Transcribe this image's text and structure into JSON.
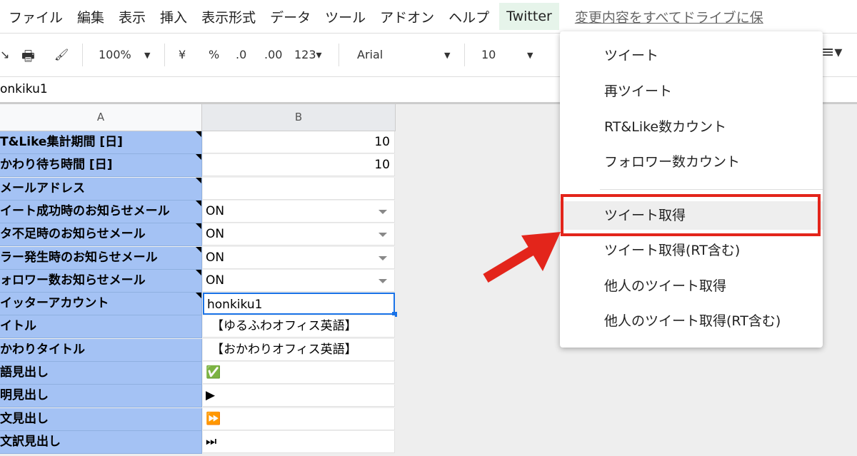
{
  "menubar": {
    "items": [
      "ファイル",
      "編集",
      "表示",
      "挿入",
      "表示形式",
      "データ",
      "ツール",
      "アドオン",
      "ヘルプ"
    ],
    "twitter": "Twitter",
    "save_status": "変更内容をすべてドライブに保"
  },
  "toolbar": {
    "zoom": "100%",
    "currency": "¥",
    "percent": "%",
    "dec_less": ".0",
    "dec_more": ".00",
    "format": "123▾",
    "font": "Arial",
    "size": "10"
  },
  "formula_bar": {
    "value": "onkiku1"
  },
  "columns": [
    "A",
    "B"
  ],
  "rows": [
    {
      "a": "T&Like集計期間 [日]",
      "b": "10",
      "type": "num"
    },
    {
      "a": "かわり待ち時間 [日]",
      "b": "10",
      "type": "num"
    },
    {
      "a": "メールアドレス",
      "b": "",
      "type": "text"
    },
    {
      "a": "イート成功時のお知らせメール",
      "b": "ON",
      "type": "dd"
    },
    {
      "a": "タ不足時のお知らせメール",
      "b": "ON",
      "type": "dd"
    },
    {
      "a": "ラー発生時のお知らせメール",
      "b": "ON",
      "type": "dd"
    },
    {
      "a": "ォロワー数お知らせメール",
      "b": "ON",
      "type": "dd"
    },
    {
      "a": "イッターアカウント",
      "b": "honkiku1",
      "type": "sel"
    },
    {
      "a": "イトル",
      "b": "【ゆるふわオフィス英語】",
      "type": "text"
    },
    {
      "a": "かわりタイトル",
      "b": "【おかわりオフィス英語】",
      "type": "text"
    },
    {
      "a": "語見出し",
      "b": "✅",
      "type": "text"
    },
    {
      "a": "明見出し",
      "b": "▶",
      "type": "text"
    },
    {
      "a": "文見出し",
      "b": "⏩",
      "type": "text"
    },
    {
      "a": "文訳見出し",
      "b": "⏭",
      "type": "text"
    }
  ],
  "twitter_menu": {
    "items": [
      "ツイート",
      "再ツイート",
      "RT&Like数カウント",
      "フォロワー数カウント",
      "ツイート取得",
      "ツイート取得(RT含む)",
      "他人のツイート取得",
      "他人のツイート取得(RT含む)"
    ],
    "highlighted": "ツイート取得"
  },
  "colors": {
    "header_fill": "#a4c2f4",
    "highlight": "#e3251b",
    "selection": "#1a73e8"
  }
}
